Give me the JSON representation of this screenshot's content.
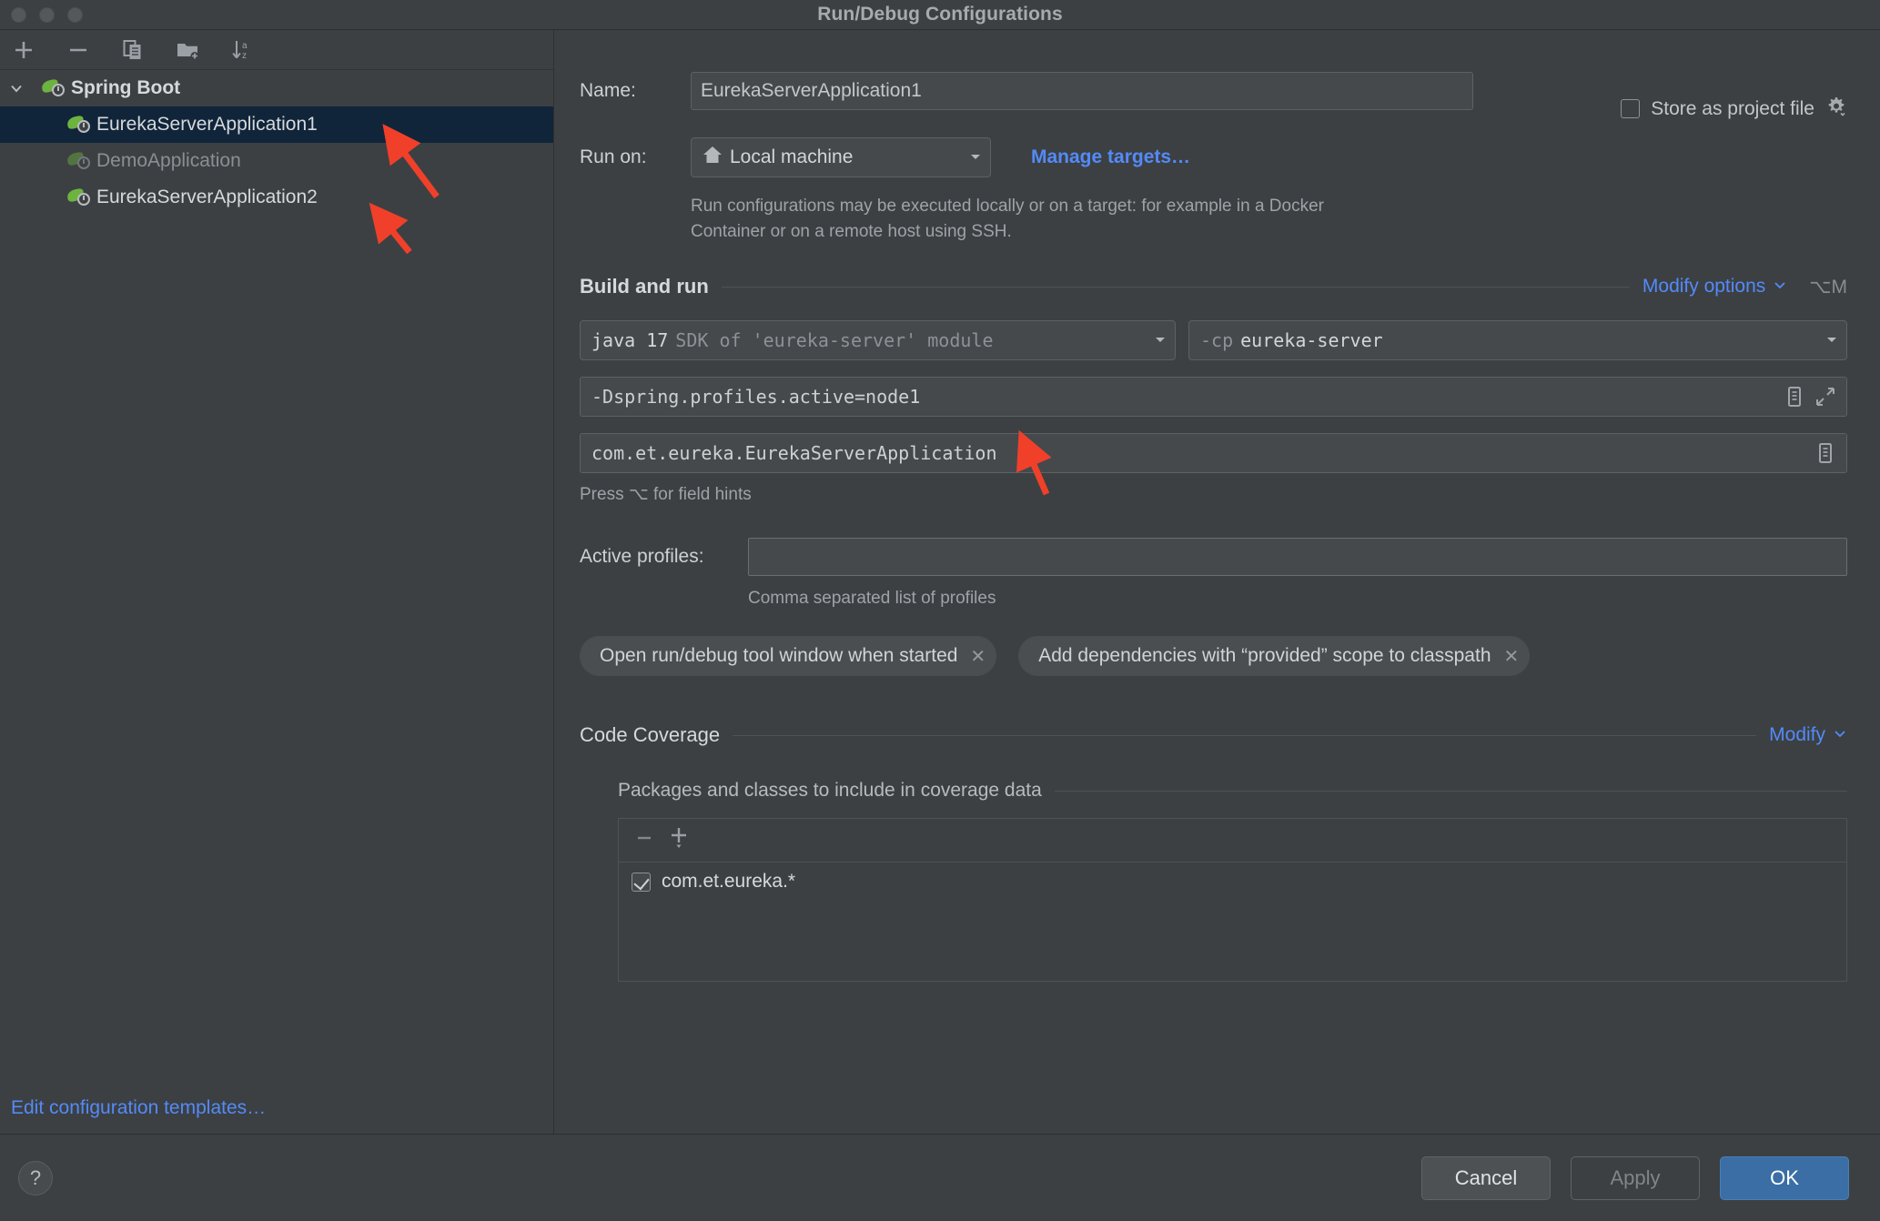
{
  "window": {
    "title": "Run/Debug Configurations",
    "traffic_lights": [
      "close-button",
      "minimize-button",
      "maximize-button"
    ]
  },
  "sidebar": {
    "toolbar": [
      {
        "name": "add-configuration-button",
        "icon": "plus-icon"
      },
      {
        "name": "remove-configuration-button",
        "icon": "minus-icon"
      },
      {
        "name": "copy-configuration-button",
        "icon": "copy-icon"
      },
      {
        "name": "new-folder-button",
        "icon": "folder-add-icon"
      },
      {
        "name": "sort-configurations-button",
        "icon": "sort-alpha-icon"
      }
    ],
    "group": {
      "label": "Spring Boot",
      "expanded": true
    },
    "items": [
      {
        "label": "EurekaServerApplication1",
        "selected": true,
        "dimmed": false
      },
      {
        "label": "DemoApplication",
        "selected": false,
        "dimmed": true
      },
      {
        "label": "EurekaServerApplication2",
        "selected": false,
        "dimmed": false
      }
    ],
    "edit_templates_link": "Edit configuration templates…"
  },
  "form": {
    "name_label": "Name:",
    "name_value": "EurekaServerApplication1",
    "store_as_project_file": {
      "label": "Store as project file",
      "checked": false,
      "gear_icon": "gear-icon"
    },
    "run_on_label": "Run on:",
    "run_on_value": "Local machine",
    "run_on_icon": "home-icon",
    "manage_targets_link": "Manage targets…",
    "run_on_helper": "Run configurations may be executed locally or on a target: for example in a Docker Container or on a remote host using SSH."
  },
  "build_and_run": {
    "title": "Build and run",
    "modify_options_label": "Modify options",
    "modify_options_shortcut": "⌥M",
    "sdk": {
      "strong": "java 17",
      "dim": "SDK of 'eureka-server' module"
    },
    "classpath": {
      "dim": "-cp",
      "strong": "eureka-server"
    },
    "vm_options_value": "-Dspring.profiles.active=node1",
    "vm_options_icons": [
      "macro-icon",
      "expand-icon"
    ],
    "main_class_value": "com.et.eureka.EurekaServerApplication",
    "main_class_icons": [
      "macro-icon"
    ],
    "field_hints": "Press ⌥ for field hints",
    "active_profiles_label": "Active profiles:",
    "active_profiles_value": "",
    "active_profiles_hint": "Comma separated list of profiles",
    "chips": [
      {
        "label": "Open run/debug tool window when started",
        "remove_icon": "close-icon"
      },
      {
        "label": "Add dependencies with “provided” scope to classpath",
        "remove_icon": "close-icon"
      }
    ]
  },
  "code_coverage": {
    "title": "Code Coverage",
    "modify_label": "Modify",
    "subsection_title": "Packages and classes to include in coverage data",
    "toolbar": [
      {
        "name": "remove-package-button",
        "icon": "minus-icon"
      },
      {
        "name": "add-package-button",
        "icon": "plus-dropdown-icon"
      }
    ],
    "rows": [
      {
        "label": "com.et.eureka.*",
        "checked": true
      }
    ]
  },
  "footer": {
    "help_label": "?",
    "cancel_label": "Cancel",
    "apply_label": "Apply",
    "ok_label": "OK"
  },
  "colors": {
    "accent_link": "#548af7",
    "ok_button": "#3a6ea5",
    "selection": "#10253a",
    "spring_green": "#6db33f",
    "annotation_arrow": "#f0402a",
    "panel": "#3c4043"
  },
  "annotations": [
    {
      "name": "arrow-to-eureka1",
      "note": "red arrow pointing at EurekaServerApplication1"
    },
    {
      "name": "arrow-to-eureka2",
      "note": "red arrow pointing at EurekaServerApplication2"
    },
    {
      "name": "arrow-to-vm-options",
      "note": "red arrow pointing at -Dspring.profiles.active=node1"
    }
  ]
}
